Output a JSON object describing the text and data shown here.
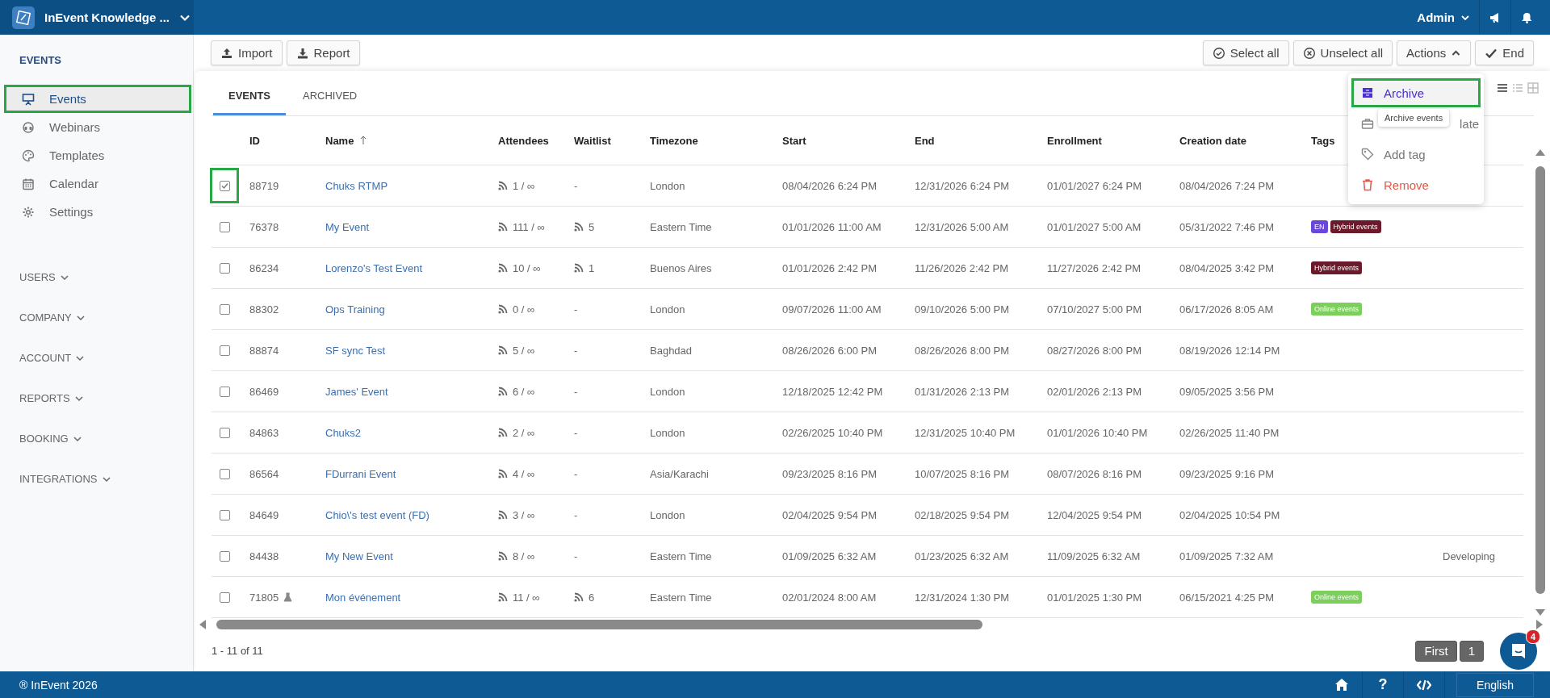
{
  "topbar": {
    "title": "InEvent Knowledge ...",
    "user": "Admin"
  },
  "sidebar": {
    "heading": "EVENTS",
    "items": [
      {
        "label": "Events",
        "selected": true,
        "highlighted": true
      },
      {
        "label": "Webinars",
        "selected": false,
        "highlighted": false
      },
      {
        "label": "Templates",
        "selected": false,
        "highlighted": false
      },
      {
        "label": "Calendar",
        "selected": false,
        "highlighted": false
      },
      {
        "label": "Settings",
        "selected": false,
        "highlighted": false
      }
    ],
    "sections": [
      {
        "label": "USERS",
        "expanded": false
      },
      {
        "label": "COMPANY",
        "expanded": false
      },
      {
        "label": "ACCOUNT",
        "expanded": false
      },
      {
        "label": "REPORTS",
        "expanded": false
      },
      {
        "label": "BOOKING",
        "expanded": false
      },
      {
        "label": "INTEGRATIONS",
        "expanded": false
      }
    ]
  },
  "toolbar": {
    "left": [
      {
        "label": "Import"
      },
      {
        "label": "Report"
      }
    ],
    "right": [
      {
        "label": "Select all"
      },
      {
        "label": "Unselect all"
      },
      {
        "label": "Actions"
      },
      {
        "label": "End"
      }
    ]
  },
  "tabs": [
    {
      "label": "EVENTS",
      "selected": true
    },
    {
      "label": "ARCHIVED",
      "selected": false
    }
  ],
  "table": {
    "columns": [
      "ID",
      "Name",
      "Attendees",
      "Waitlist",
      "Timezone",
      "Start",
      "End",
      "Enrollment",
      "Creation date",
      "Tags"
    ],
    "rows": [
      {
        "checked": true,
        "highlighted": true,
        "id": "88719",
        "beta": false,
        "name": "Chuks RTMP",
        "attendees": "1 / ∞",
        "waitlist": {
          "kind": "empty",
          "text": "-"
        },
        "timezone": "London",
        "start": "08/04/2026 6:24 PM",
        "end": "12/31/2026 6:24 PM",
        "enrollment": "01/01/2027 6:24 PM",
        "created": "08/04/2026 7:24 PM",
        "tags": []
      },
      {
        "checked": false,
        "highlighted": false,
        "id": "76378",
        "beta": false,
        "name": "My Event",
        "attendees": "111 / ∞",
        "waitlist": {
          "kind": "feed",
          "text": "5"
        },
        "timezone": "Eastern Time",
        "start": "01/01/2026 11:00 AM",
        "end": "12/31/2026 5:00 AM",
        "enrollment": "01/01/2027 5:00 AM",
        "created": "05/31/2022 7:46 PM",
        "tags": [
          {
            "text": "EN",
            "color": "#6a47d9"
          },
          {
            "text": "Hybrid events",
            "color": "#6b1a2b"
          }
        ]
      },
      {
        "checked": false,
        "highlighted": false,
        "id": "86234",
        "beta": false,
        "name": "Lorenzo's Test Event",
        "attendees": "10 / ∞",
        "waitlist": {
          "kind": "feed",
          "text": "1"
        },
        "timezone": "Buenos Aires",
        "start": "01/01/2026 2:42 PM",
        "end": "11/26/2026 2:42 PM",
        "enrollment": "11/27/2026 2:42 PM",
        "created": "08/04/2025 3:42 PM",
        "tags": [
          {
            "text": "Hybrid events",
            "color": "#6b1a2b"
          }
        ]
      },
      {
        "checked": false,
        "highlighted": false,
        "id": "88302",
        "beta": false,
        "name": "Ops Training",
        "attendees": "0 / ∞",
        "waitlist": {
          "kind": "empty",
          "text": "-"
        },
        "timezone": "London",
        "start": "09/07/2026 11:00 AM",
        "end": "09/10/2026 5:00 PM",
        "enrollment": "07/10/2027 5:00 PM",
        "created": "06/17/2026 8:05 AM",
        "tags": [
          {
            "text": "Online events",
            "color": "#7ccf5c"
          }
        ]
      },
      {
        "checked": false,
        "highlighted": false,
        "id": "88874",
        "beta": false,
        "name": "SF sync Test",
        "attendees": "5 / ∞",
        "waitlist": {
          "kind": "empty",
          "text": "-"
        },
        "timezone": "Baghdad",
        "start": "08/26/2026 6:00 PM",
        "end": "08/26/2026 8:00 PM",
        "enrollment": "08/27/2026 8:00 PM",
        "created": "08/19/2026 12:14 PM",
        "tags": []
      },
      {
        "checked": false,
        "highlighted": false,
        "id": "86469",
        "beta": false,
        "name": "James' Event",
        "attendees": "6 / ∞",
        "waitlist": {
          "kind": "empty",
          "text": "-"
        },
        "timezone": "London",
        "start": "12/18/2025 12:42 PM",
        "end": "01/31/2026 2:13 PM",
        "enrollment": "02/01/2026 2:13 PM",
        "created": "09/05/2025 3:56 PM",
        "tags": []
      },
      {
        "checked": false,
        "highlighted": false,
        "id": "84863",
        "beta": false,
        "name": "Chuks2",
        "attendees": "2 / ∞",
        "waitlist": {
          "kind": "empty",
          "text": "-"
        },
        "timezone": "London",
        "start": "02/26/2025 10:40 PM",
        "end": "12/31/2025 10:40 PM",
        "enrollment": "01/01/2026 10:40 PM",
        "created": "02/26/2025 11:40 PM",
        "tags": []
      },
      {
        "checked": false,
        "highlighted": false,
        "id": "86564",
        "beta": false,
        "name": "FDurrani Event",
        "attendees": "4 / ∞",
        "waitlist": {
          "kind": "empty",
          "text": "-"
        },
        "timezone": "Asia/Karachi",
        "start": "09/23/2025 8:16 PM",
        "end": "10/07/2025 8:16 PM",
        "enrollment": "08/07/2026 8:16 PM",
        "created": "09/23/2025 9:16 PM",
        "tags": []
      },
      {
        "checked": false,
        "highlighted": false,
        "id": "84649",
        "beta": false,
        "name": "Chio\\'s test event (FD)",
        "attendees": "3 / ∞",
        "waitlist": {
          "kind": "empty",
          "text": "-"
        },
        "timezone": "London",
        "start": "02/04/2025 9:54 PM",
        "end": "02/18/2025 9:54 PM",
        "enrollment": "12/04/2025 9:54 PM",
        "created": "02/04/2025 10:54 PM",
        "tags": []
      },
      {
        "checked": false,
        "highlighted": false,
        "id": "84438",
        "beta": false,
        "name": "My New Event",
        "attendees": "8 / ∞",
        "waitlist": {
          "kind": "empty",
          "text": "-"
        },
        "timezone": "Eastern Time",
        "start": "01/09/2025 6:32 AM",
        "end": "01/23/2025 6:32 AM",
        "enrollment": "11/09/2025 6:32 AM",
        "created": "01/09/2025 7:32 AM",
        "tags": [],
        "column_11": "Developing"
      },
      {
        "checked": false,
        "highlighted": false,
        "id": "71805",
        "beta": true,
        "name": "Mon événement",
        "attendees": "11 / ∞",
        "waitlist": {
          "kind": "feed",
          "text": "6"
        },
        "timezone": "Eastern Time",
        "start": "02/01/2024 8:00 AM",
        "end": "12/31/2024 1:30 PM",
        "enrollment": "01/01/2025 1:30 PM",
        "created": "06/15/2021 4:25 PM",
        "tags": [
          {
            "text": "Online events",
            "color": "#7ccf5c"
          }
        ]
      }
    ]
  },
  "pagination": {
    "summary": "1 - 11 of 11",
    "buttons": [
      "First",
      "1"
    ]
  },
  "actions_menu": {
    "items": [
      {
        "label": "Archive",
        "kind": "primary",
        "highlighted": true
      },
      {
        "label": "late",
        "kind": "normal",
        "highlighted": false
      },
      {
        "label": "Add tag",
        "kind": "normal",
        "highlighted": false
      },
      {
        "label": "Remove",
        "kind": "danger",
        "highlighted": false
      }
    ],
    "tooltip": "Archive events"
  },
  "chat": {
    "badge": "4"
  },
  "footer": {
    "copyright": "® InEvent 2026",
    "help": "?",
    "language": "English"
  }
}
